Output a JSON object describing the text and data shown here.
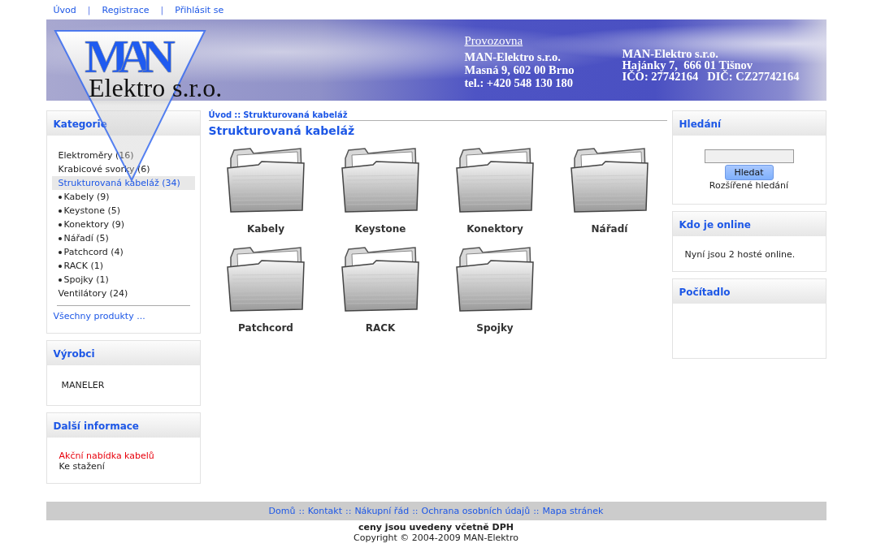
{
  "top_nav": {
    "separator": "|",
    "links": [
      "Úvod",
      "Registrace",
      "Přihlásit se"
    ]
  },
  "header": {
    "logo": {
      "mark": "MAN",
      "word": "Elektro",
      "suffix": "s.r.o."
    },
    "branch": {
      "heading": "Provozovna",
      "lines": [
        "MAN-Elektro s.r.o.",
        "Masná 9, 602 00 Brno",
        "tel.: +420 548 130 180"
      ]
    },
    "company": {
      "lines": [
        "MAN-Elektro s.r.o.",
        "Hajánky 7,  666 01 Tišnov",
        "IČO: 27742164   DIČ: CZ27742164"
      ]
    }
  },
  "categories": {
    "title": "Kategorie",
    "items": [
      {
        "label": "Elektroměry (16)",
        "selected": false
      },
      {
        "label": "Krabicové svorky (6)",
        "selected": false
      },
      {
        "label": "Strukturovaná kabeláž (34)",
        "selected": true,
        "children": [
          {
            "label": "Kabely (9)",
            "selected": false
          },
          {
            "label": "Keystone (5)",
            "selected": false
          },
          {
            "label": "Konektory (9)",
            "selected": false
          },
          {
            "label": "Nářadí (5)",
            "selected": false
          },
          {
            "label": "Patchcord (4)",
            "selected": false
          },
          {
            "label": "RACK (1)",
            "selected": false
          },
          {
            "label": "Spojky (1)",
            "selected": false
          }
        ]
      },
      {
        "label": "Ventilátory (24)",
        "selected": false
      }
    ],
    "all_products": "Všechny produkty ..."
  },
  "manufacturers": {
    "title": "Výrobci",
    "items": [
      "MANELER"
    ]
  },
  "more_info": {
    "title": "Další informace",
    "links": [
      {
        "label": "Akční nabídka kabelů",
        "kind": "promo"
      },
      {
        "label": "Ke stažení",
        "kind": "plain"
      }
    ]
  },
  "breadcrumb": {
    "separator": "::",
    "items": [
      "Úvod",
      "Strukturovaná kabeláž"
    ]
  },
  "page_title": "Strukturovaná kabeláž",
  "subcategories": [
    {
      "label": "Kabely"
    },
    {
      "label": "Keystone"
    },
    {
      "label": "Konektory"
    },
    {
      "label": "Nářadí"
    },
    {
      "label": "Patchcord"
    },
    {
      "label": "RACK"
    },
    {
      "label": "Spojky"
    }
  ],
  "search": {
    "title": "Hledání",
    "button": "Hledat",
    "advanced_link": "Rozšířené hledání"
  },
  "online": {
    "title": "Kdo je online",
    "text": "Nyní jsou 2 hosté online."
  },
  "counter": {
    "title": "Počítadlo"
  },
  "footer": {
    "separator": "::",
    "links": [
      "Domů",
      "Kontakt",
      "Nákupní řád",
      "Ochrana osobních údajů",
      "Mapa stránek"
    ],
    "note": "ceny jsou uvedeny včetně DPH",
    "copyright": "Copyright © 2004-2009 MAN-Elektro"
  }
}
